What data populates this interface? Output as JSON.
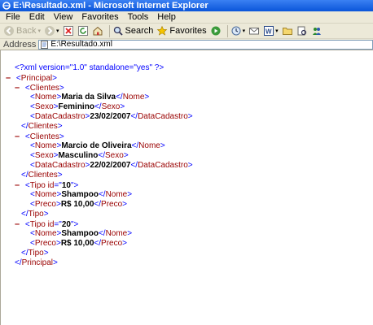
{
  "window": {
    "title": "E:\\Resultado.xml - Microsoft Internet Explorer"
  },
  "menu": [
    "File",
    "Edit",
    "View",
    "Favorites",
    "Tools",
    "Help"
  ],
  "toolbar": {
    "back_label": "Back",
    "search_label": "Search",
    "favorites_label": "Favorites"
  },
  "address": {
    "label": "Address",
    "value": "E:\\Resultado.xml"
  },
  "xml": {
    "declaration": "<?xml version=\"1.0\" standalone=\"yes\" ?>",
    "root": "Principal",
    "clientes_tag": "Clientes",
    "clientes": [
      {
        "nome": "Maria da Silva",
        "sexo": "Feminino",
        "data": "23/02/2007"
      },
      {
        "nome": "Marcio de Oliveira",
        "sexo": "Masculino",
        "data": "22/02/2007"
      }
    ],
    "tipos": [
      {
        "id": "10",
        "nome": "Shampoo",
        "preco": "R$ 10,00"
      },
      {
        "id": "20",
        "nome": "Shampoo",
        "preco": "R$ 10,00"
      }
    ],
    "tag_names": {
      "nome": "Nome",
      "sexo": "Sexo",
      "data": "DataCadastro",
      "tipo": "Tipo",
      "preco": "Preco",
      "id_attr": "id"
    },
    "collapse_marker": "–"
  }
}
